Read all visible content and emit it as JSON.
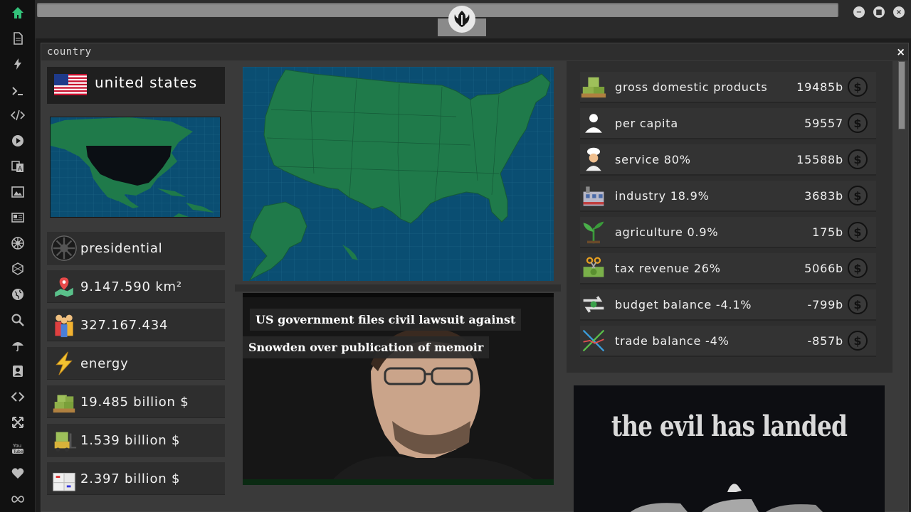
{
  "sidebar": {
    "icons": [
      "home-icon",
      "document-icon",
      "bolt-icon",
      "terminal-icon",
      "code-icon",
      "play-icon",
      "translate-icon",
      "image-icon",
      "newspaper-icon",
      "empire-icon",
      "hexagon-icon",
      "globe-icon",
      "search-icon",
      "umbrella-icon",
      "contact-icon",
      "link-icon",
      "expand-icon",
      "youtube-icon",
      "heart-icon",
      "infinity-icon"
    ]
  },
  "window": {
    "logo": "rebel-alliance-logo"
  },
  "panel": {
    "title": "country",
    "close": "×"
  },
  "country": {
    "name": "united states",
    "flag": "us-flag-icon",
    "stats": [
      {
        "icon": "empire-icon",
        "label": "presidential"
      },
      {
        "icon": "map-pin-icon",
        "label": "9.147.590 km²"
      },
      {
        "icon": "people-icon",
        "label": "327.167.434"
      },
      {
        "icon": "lightning-icon",
        "label": "energy"
      },
      {
        "icon": "money-pallet-icon",
        "label": "19.485 billion $"
      },
      {
        "icon": "forklift-icon",
        "label": "1.539 billion $"
      },
      {
        "icon": "boxes-icon",
        "label": "2.397 billion $"
      }
    ]
  },
  "news": {
    "headline_line1": "US government files civil lawsuit against",
    "headline_line2": "Snowden over publication of memoir"
  },
  "economy": [
    {
      "icon": "money-pallet-icon",
      "label": "gross domestic products",
      "value": "19485b"
    },
    {
      "icon": "person-icon",
      "label": "per capita",
      "value": "59557"
    },
    {
      "icon": "chef-icon",
      "label": "service 80%",
      "value": "15588b"
    },
    {
      "icon": "factory-icon",
      "label": "industry 18.9%",
      "value": "3683b"
    },
    {
      "icon": "plant-icon",
      "label": "agriculture 0.9%",
      "value": "175b"
    },
    {
      "icon": "scissors-money-icon",
      "label": "tax revenue 26%",
      "value": "5066b"
    },
    {
      "icon": "exchange-icon",
      "label": "budget balance -4.1%",
      "value": "-799b"
    },
    {
      "icon": "trade-icon",
      "label": "trade balance -4%",
      "value": "-857b"
    }
  ],
  "coin_symbol": "$",
  "poster": {
    "text": "the evil has landed"
  }
}
